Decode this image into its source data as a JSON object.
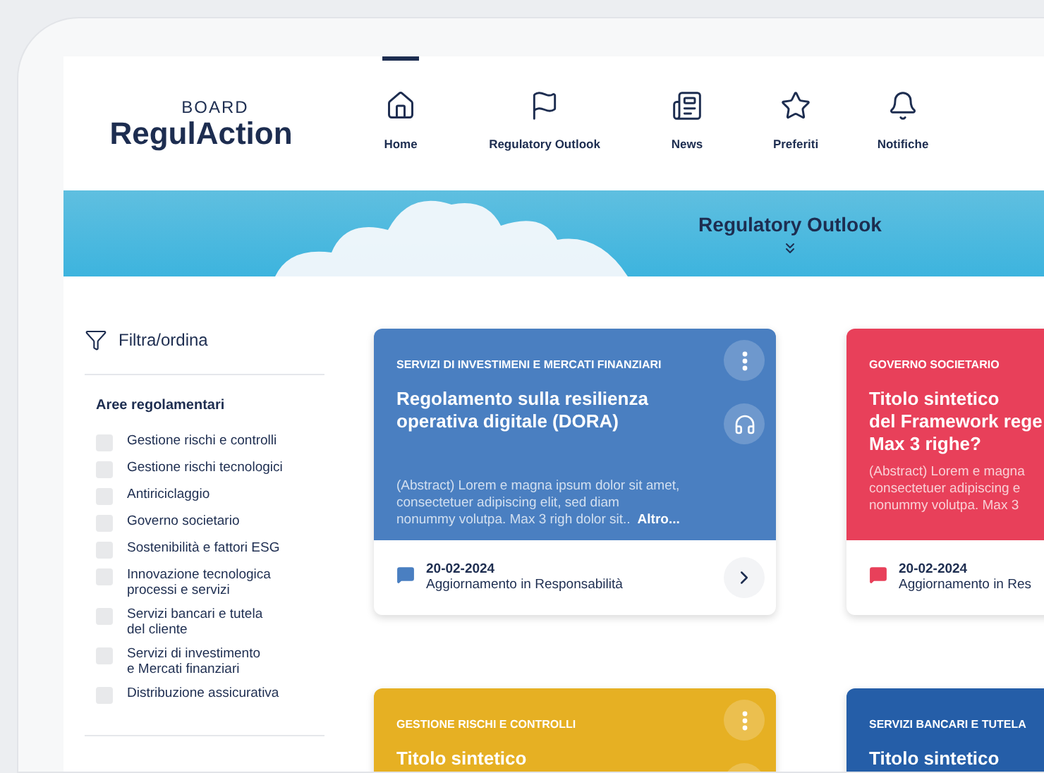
{
  "logo": {
    "top": "BOARD",
    "main": "RegulAction"
  },
  "nav": [
    {
      "label": "Home",
      "selected": true
    },
    {
      "label": "Regulatory Outlook",
      "selected": false
    },
    {
      "label": "News",
      "selected": false
    },
    {
      "label": "Preferiti",
      "selected": false
    },
    {
      "label": "Notifiche",
      "selected": false
    }
  ],
  "banner": {
    "title": "Regulatory Outlook"
  },
  "filter": {
    "title": "Filtra/ordina",
    "section": "Aree regolamentari",
    "items": [
      {
        "label": "Gestione rischi e controlli",
        "checked": false
      },
      {
        "label": "Gestione rischi tecnologici",
        "checked": false
      },
      {
        "label": "Antiriciclaggio",
        "checked": false
      },
      {
        "label": "Governo societario",
        "checked": false
      },
      {
        "label": "Sostenibilità e fattori ESG",
        "checked": false
      },
      {
        "label": "Innovazione tecnologica\nprocessi e servizi",
        "checked": false
      },
      {
        "label": "Servizi bancari e tutela\ndel cliente",
        "checked": false
      },
      {
        "label": "Servizi di investimento\ne Mercati finanziari",
        "checked": false
      },
      {
        "label": "Distribuzione assicurativa",
        "checked": false
      }
    ]
  },
  "cards": [
    {
      "color": "#4a7fc1",
      "category": "SERVIZI DI INVESTIMENI E MERCATI FINANZIARI",
      "title_lines": [
        "Regolamento sulla resilienza",
        "operativa digitale (DORA)"
      ],
      "abstract_lines": [
        "(Abstract) Lorem e magna ipsum dolor sit amet,",
        "consectetuer adipiscing elit, sed diam",
        "nonummy volutpa. Max 3 righ dolor sit.."
      ],
      "more": "Altro...",
      "date": "20-02-2024",
      "update": "Aggiornamento in Responsabilità",
      "menu": true,
      "audio": true,
      "arrow": true
    },
    {
      "color": "#e8405a",
      "category": "GOVERNO SOCIETARIO",
      "title_lines": [
        "Titolo sintetico",
        "del Framework rege",
        "Max 3 righe?"
      ],
      "abstract_lines": [
        "(Abstract) Lorem e magna",
        "consectetuer adipiscing e",
        "nonummy volutpa. Max 3"
      ],
      "date": "20-02-2024",
      "update": "Aggiornamento in Res",
      "menu": false,
      "audio": false,
      "arrow": false
    },
    {
      "color": "#e6b023",
      "category": "GESTIONE RISCHI E CONTROLLI",
      "title_lines": [
        "Titolo sintetico"
      ],
      "menu": true,
      "audio": true,
      "arrow": false
    },
    {
      "color": "#255ea8",
      "category": "SERVIZI BANCARI E TUTELA",
      "title_lines": [
        "Titolo sintetico"
      ],
      "menu": false,
      "audio": false,
      "arrow": false
    }
  ]
}
